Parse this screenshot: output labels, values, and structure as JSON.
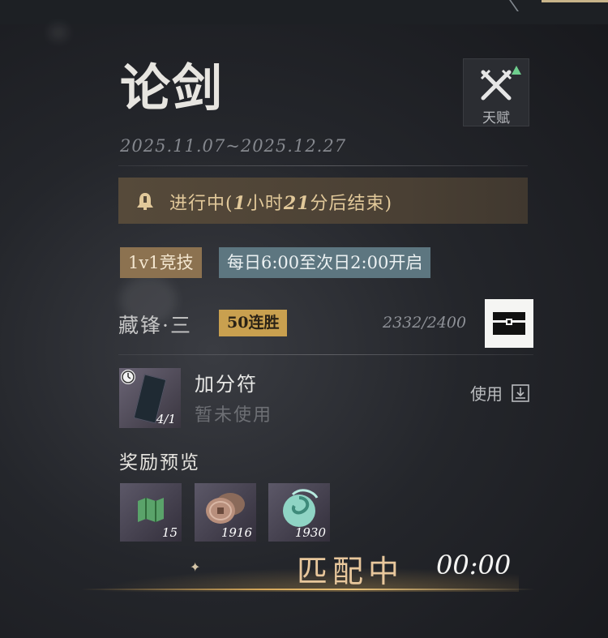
{
  "event": {
    "title": "论剑",
    "date_range": "2025.11.07~2025.12.27",
    "talent_label": "天赋"
  },
  "status": {
    "prefix": "进行中(",
    "hours": "1",
    "hour_unit": "小时",
    "minutes": "21",
    "suffix": "分后结束)"
  },
  "mode": {
    "tag": "1v1竞技",
    "schedule": "每日6:00至次日2:00开启"
  },
  "rank": {
    "tier": "藏锋·三",
    "streak": "50连胜",
    "score": "2332/2400"
  },
  "item": {
    "name": "加分符",
    "status": "暂未使用",
    "count": "4/1",
    "use_label": "使用"
  },
  "rewards": {
    "title": "奖励预览",
    "items": [
      {
        "qty": "15",
        "icon": "map-scroll-icon"
      },
      {
        "qty": "1916",
        "icon": "coins-icon"
      },
      {
        "qty": "1930",
        "icon": "jade-swirl-icon"
      }
    ]
  },
  "matching": {
    "label": "匹配中",
    "timer": "00:00"
  },
  "colors": {
    "accent_gold": "#c9a04f",
    "status_text": "#e2c99a",
    "mode_tag": "#8c7250",
    "schedule_tag": "#5d7680",
    "talent_up": "#6fcf8e"
  }
}
